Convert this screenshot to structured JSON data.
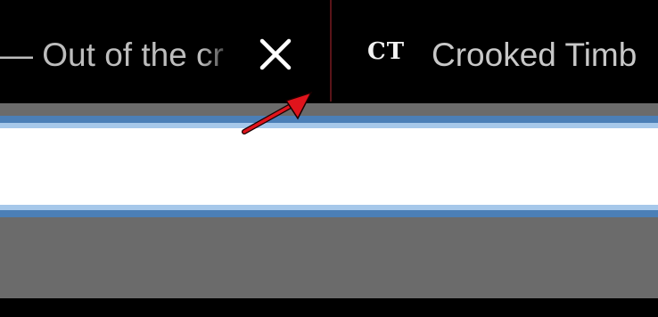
{
  "tabs": [
    {
      "title": "— Out of the cr",
      "close_icon": "close-icon"
    },
    {
      "favicon_text": "CT",
      "title": "Crooked Timb"
    }
  ],
  "url_bar": {
    "value": ""
  },
  "colors": {
    "tab_bar_background": "#000000",
    "tab_separator": "#5a1418",
    "toolbar_background": "#6b6b6b",
    "urlbar_focus_ring": "#4b7fb7",
    "urlbar_focus_ring_light": "#a6c8ea",
    "annotation_arrow": "#e0141c"
  },
  "annotation": {
    "icon": "red-arrow-icon"
  }
}
